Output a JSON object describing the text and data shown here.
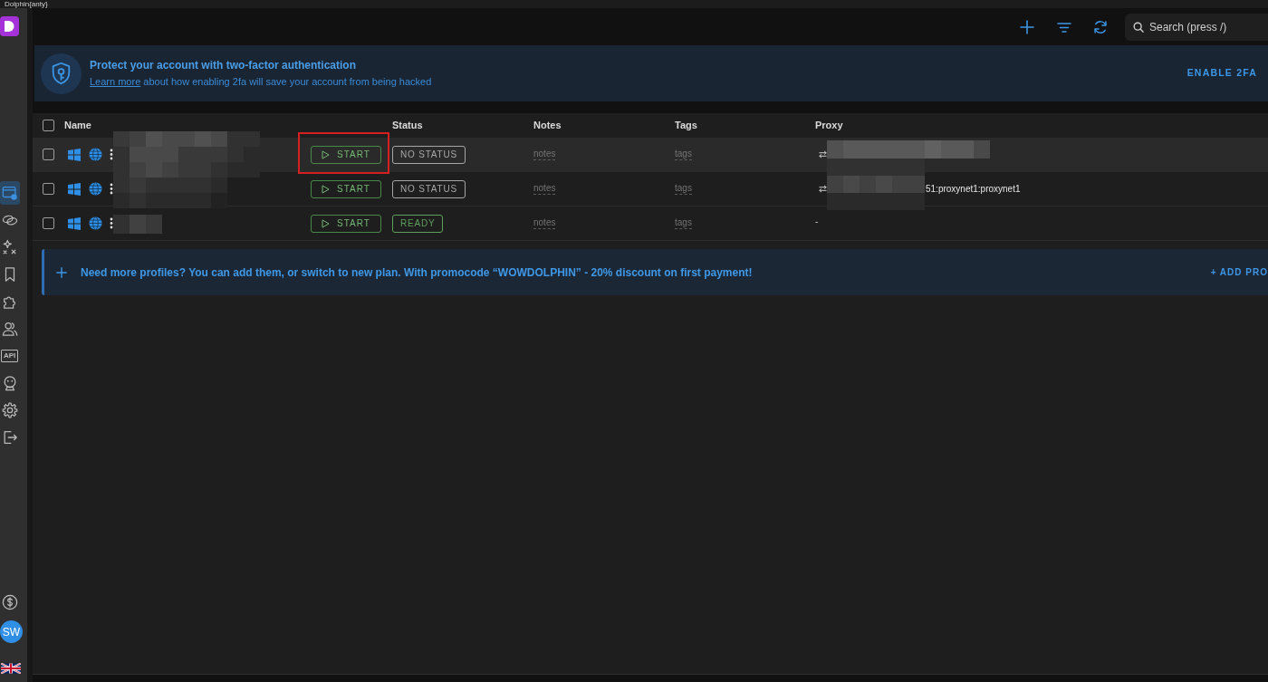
{
  "window": {
    "title": "Dolphin{anty}"
  },
  "sidebar": {
    "items": [
      {
        "kind": "profiles",
        "selected": true
      },
      {
        "kind": "link",
        "selected": false
      },
      {
        "kind": "sparkles",
        "selected": false
      },
      {
        "kind": "bookmark",
        "selected": false
      },
      {
        "kind": "puzzle",
        "selected": false
      },
      {
        "kind": "users",
        "selected": false
      },
      {
        "kind": "api",
        "label": "API",
        "selected": false
      },
      {
        "kind": "bot",
        "selected": false
      },
      {
        "kind": "settings",
        "selected": false
      },
      {
        "kind": "logout",
        "selected": false
      }
    ],
    "avatar": "SW"
  },
  "toolbar": {
    "search": {
      "placeholder": "Search (press /)"
    }
  },
  "two_factor_banner": {
    "title": "Protect your account with two-factor authentication",
    "link": "Learn more",
    "text": "about how enabling 2fa will save your account from being hacked",
    "action": "ENABLE 2FA"
  },
  "table": {
    "header_checkbox": {
      "checked": false
    },
    "columns": [
      "Name",
      "Status",
      "Notes",
      "Tags",
      "Proxy"
    ],
    "rows": [
      {
        "checked": false,
        "hovered": true,
        "highlighted": true,
        "action": "START",
        "status": {
          "text": "NO STATUS",
          "color": "#a6a6a6"
        },
        "notes": "notes",
        "tags": "tags",
        "proxy": {
          "kind": "assigned"
        }
      },
      {
        "checked": false,
        "hovered": false,
        "highlighted": false,
        "action": "START",
        "status": {
          "text": "NO STATUS",
          "color": "#a6a6a6"
        },
        "notes": "notes",
        "tags": "tags",
        "proxy": {
          "kind": "assigned",
          "text": "51:proxynet1:proxynet1"
        }
      },
      {
        "checked": false,
        "hovered": false,
        "highlighted": false,
        "action": "START",
        "status": {
          "text": "READY",
          "color": "#5d9f5d"
        },
        "notes": "notes",
        "tags": "tags",
        "proxy": {
          "kind": "none",
          "text": "-"
        }
      }
    ]
  },
  "promo_banner": {
    "text": "Need more profiles? You can add them, or switch to new plan. With promocode “WOWDOLPHIN” - 20% discount on first payment!",
    "action": "+ ADD PRO"
  }
}
